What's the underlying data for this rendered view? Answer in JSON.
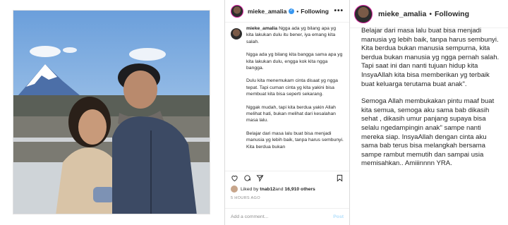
{
  "account": {
    "username": "mieke_amalia",
    "separator": "•",
    "follow_label": "Following",
    "menu": "•••"
  },
  "post": {
    "caption_paragraphs": [
      "Ngga ada yg bilang apa yg kita lakukan dulu itu bener, iya emang kita salah.",
      "Ngga ada yg bilang kita bangga sama apa yg kita lakukan dulu, engga kok kita ngga bangga.",
      "Dulu kita menemukam cinta disaat yg ngga tepat. Tapi cuman cinta yg kita yakini bisa membuat kita bisa seperti sekarang.",
      "Nggak mudah, tapi kita berdua yakin Allah melihat hati, bukan melihat dari kesalahan masa lalu.",
      "Belajar dari masa lalu buat bisa menjadi manusia yg lebih baik, tanpa harus sembunyi. Kita berdua bukan"
    ],
    "liked_by_prefix": "Liked by ",
    "liked_by_user": "tnab12",
    "liked_by_and": " and ",
    "liked_by_others": "16,910 others",
    "time_ago": "5 HOURS AGO",
    "comment_placeholder": "Add a comment...",
    "post_button": "Post"
  },
  "zoom": {
    "paragraphs": [
      "Belajar dari masa lalu buat bisa menjadi manusia yg lebih baik, tanpa harus sembunyi. Kita berdua bukan manusia sempurna, kita berdua bukan manusia yg ngga pernah salah. Tapi saat ini dan nanti tujuan hidup kita InsyaAllah kita bisa memberikan yg terbaik buat keluarga terutama buat anak\".",
      "Semoga Allah membukakan pintu maaf buat kita semua, semoga aku sama bab dikasih sehat , dikasih umur panjang supaya bisa selalu ngedampingin anak\" sampe nanti mereka siap. InsyaAllah dengan cinta aku sama bab terus bisa melangkah bersama sampe rambut memutih dan sampai usia memisahkan.. Amiiinnnn YRA."
    ]
  },
  "colors": {
    "link_blue": "#3897f0",
    "post_button_disabled": "#b2dffc",
    "story_ring": "#d6249f"
  },
  "icons": [
    "heart-icon",
    "comment-icon",
    "share-icon",
    "bookmark-icon",
    "verified-icon",
    "more-icon"
  ]
}
